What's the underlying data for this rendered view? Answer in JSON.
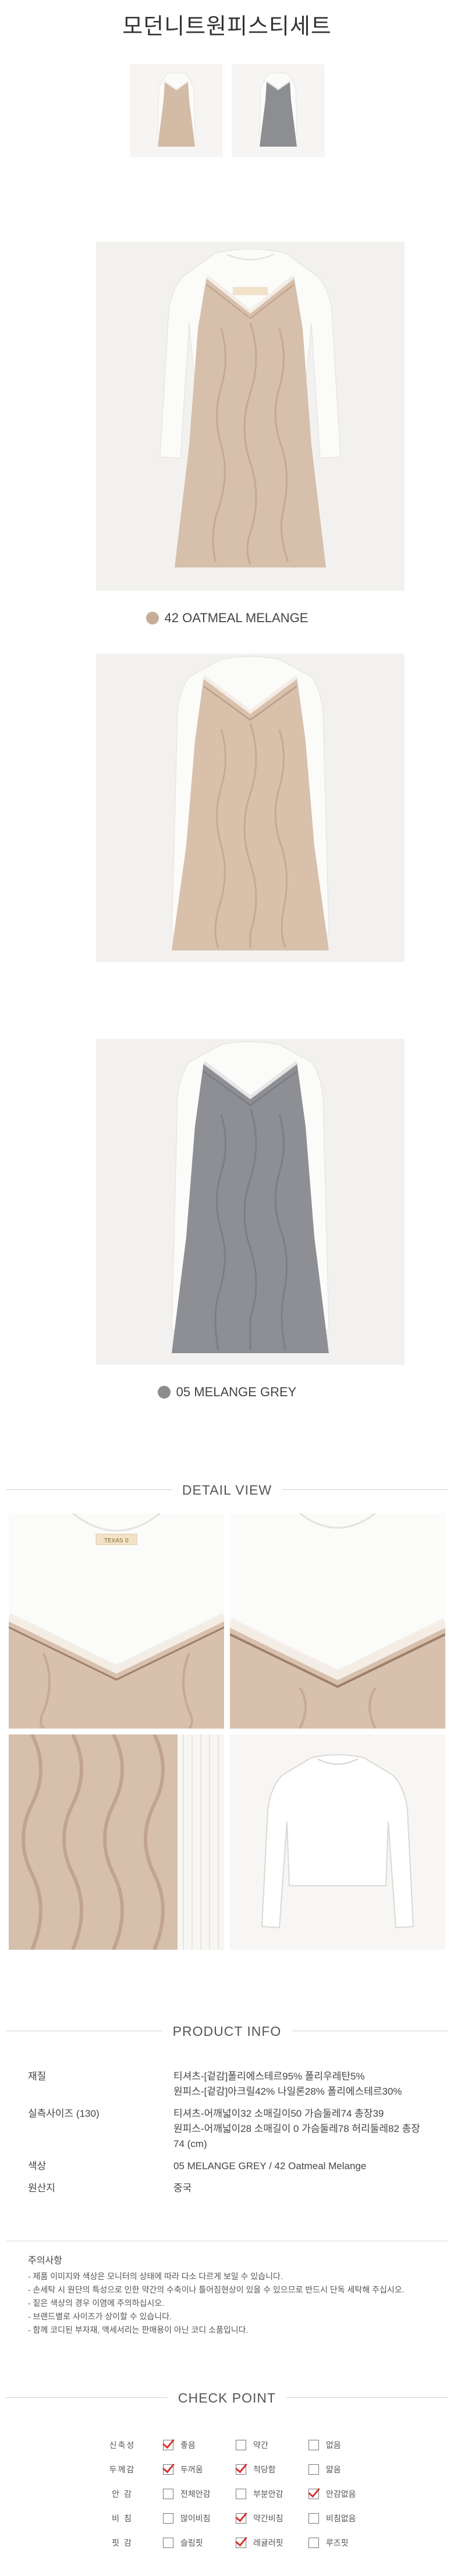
{
  "page": {
    "title": "모던니트원피스티세트",
    "captions": {
      "oatmeal": "42 OATMEAL MELANGE",
      "grey": "05 MELANGE GREY"
    },
    "swatch_colors": {
      "oatmeal": "#c7ad98",
      "grey": "#8c8c8c"
    },
    "label_tag": "TEXAS 0",
    "detail_header": "DETAIL VIEW",
    "product_info_header": "PRODUCT INFO",
    "check_point_header": "CHECK POINT"
  },
  "product_info": [
    {
      "label": "재질",
      "lines": [
        "티셔츠-[겉감]폴리에스테르95% 폴리우레탄5%",
        "원피스-[겉감]아크릴42% 나일론28% 폴리에스테르30%"
      ]
    },
    {
      "label": "실측사이즈 (130)",
      "lines": [
        "티셔츠-어깨넓이32 소매길이50 가슴둘레74 총장39",
        "원피스-어깨넓이28 소매길이 0 가슴둘레78 허리둘레82 총장74  (cm)"
      ]
    },
    {
      "label": "색상",
      "lines": [
        "05 MELANGE GREY / 42 Oatmeal Melange"
      ]
    },
    {
      "label": "원산지",
      "lines": [
        "중국"
      ]
    }
  ],
  "notice": {
    "title": "주의사항",
    "items": [
      "- 제품 이미지와 색상은 모니터의 상태에 따라 다소 다르게 보일 수 있습니다.",
      "- 손세탁 시 원단의 특성으로 인한 약간의 수축이나 틀어짐현상이 있을 수 있으므로 반드시 단독 세탁해 주십시오.",
      "- 짙은 색상의 경우 이염에 주의하십시오.",
      "- 브랜드별로 사이즈가 상이할 수 있습니다.",
      "- 함께 코디된 부자재, 액세서리는 판매용이 아닌 코디 소품입니다."
    ]
  },
  "check_point": [
    {
      "label": "신축성",
      "options": [
        {
          "text": "좋음",
          "checked": true
        },
        {
          "text": "약간",
          "checked": false
        },
        {
          "text": "없음",
          "checked": false
        }
      ]
    },
    {
      "label": "두께감",
      "options": [
        {
          "text": "두꺼움",
          "checked": true
        },
        {
          "text": "적당함",
          "checked": true
        },
        {
          "text": "얇음",
          "checked": false
        }
      ]
    },
    {
      "label": "안 감",
      "options": [
        {
          "text": "전체안감",
          "checked": false
        },
        {
          "text": "부분안감",
          "checked": false
        },
        {
          "text": "안감없음",
          "checked": true
        }
      ]
    },
    {
      "label": "비 침",
      "options": [
        {
          "text": "많이비침",
          "checked": false
        },
        {
          "text": "약간비침",
          "checked": true
        },
        {
          "text": "비침없음",
          "checked": false
        }
      ]
    },
    {
      "label": "핏 감",
      "options": [
        {
          "text": "슬림핏",
          "checked": false
        },
        {
          "text": "레귤러핏",
          "checked": true
        },
        {
          "text": "루즈핏",
          "checked": false
        }
      ]
    }
  ]
}
